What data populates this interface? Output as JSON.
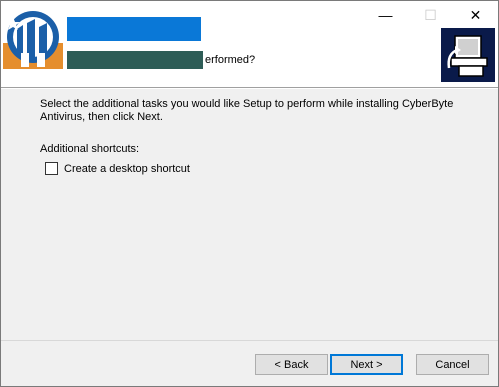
{
  "window": {
    "controls": {
      "minimize": "—",
      "maximize": "☐",
      "close": "✕"
    }
  },
  "header": {
    "subtitle_visible": "erformed?",
    "logo_icon": "cyberbyte-logo-icon",
    "image_icon": "computer-install-icon"
  },
  "content": {
    "instructions": "Select the additional tasks you would like Setup to perform while installing CyberByte Antivirus, then click Next.",
    "section_label": "Additional shortcuts:",
    "tasks": [
      {
        "label": "Create a desktop shortcut",
        "checked": false
      }
    ]
  },
  "buttons": {
    "back": "< Back",
    "next": "Next >",
    "cancel": "Cancel"
  },
  "colors": {
    "accent": "#0078d7",
    "redact_title": "#0a78d7",
    "redact_sub": "#2e5d57"
  }
}
